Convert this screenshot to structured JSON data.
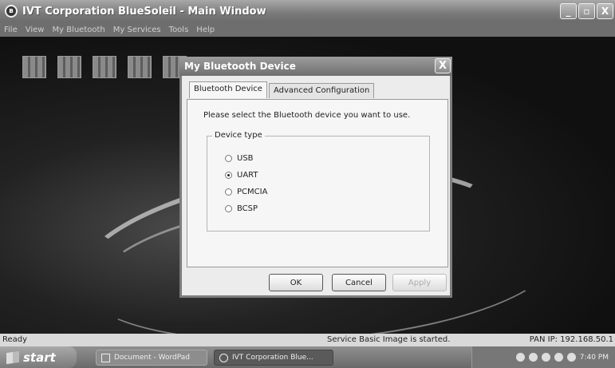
{
  "window": {
    "title": "IVT Corporation BlueSoleil - Main Window",
    "minimize": "_",
    "maximize": "▫",
    "close": "X"
  },
  "menu": [
    "File",
    "View",
    "My Bluetooth",
    "My Services",
    "Tools",
    "Help"
  ],
  "dialog": {
    "title": "My Bluetooth Device",
    "close": "X",
    "tabs": [
      "Bluetooth Device",
      "Advanced Configuration"
    ],
    "prompt": "Please select the Bluetooth device you want to use.",
    "group_label": "Device type",
    "options": [
      "USB",
      "UART",
      "PCMCIA",
      "BCSP"
    ],
    "selected": "UART",
    "buttons": {
      "ok": "OK",
      "cancel": "Cancel",
      "apply": "Apply"
    }
  },
  "status": {
    "left": "Ready",
    "middle": "Service Basic Image is started.",
    "right": "PAN IP: 192.168.50.1"
  },
  "taskbar": {
    "start": "start",
    "tasks": [
      "Document - WordPad",
      "IVT Corporation Blue..."
    ],
    "clock": "7:40 PM"
  }
}
